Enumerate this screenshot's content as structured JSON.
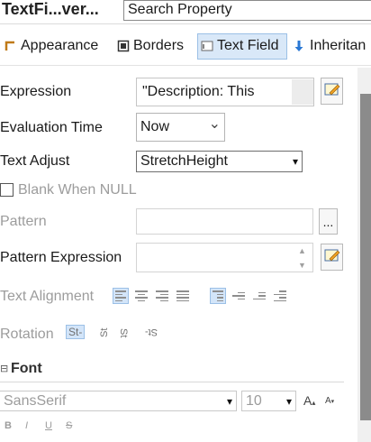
{
  "header": {
    "title": "TextFi...ver...",
    "search_value": "Search Property"
  },
  "tabs": [
    {
      "label": "Appearance"
    },
    {
      "label": "Borders"
    },
    {
      "label": "Text Field"
    },
    {
      "label": "Inheritan"
    }
  ],
  "properties": {
    "expression": {
      "label": "Expression",
      "value": "\"Description: This"
    },
    "evaluation_time": {
      "label": "Evaluation Time",
      "value": "Now"
    },
    "text_adjust": {
      "label": "Text Adjust",
      "value": "StretchHeight"
    },
    "blank_when_null": {
      "label": "Blank When NULL",
      "checked": false
    },
    "pattern": {
      "label": "Pattern",
      "value": "",
      "button_label": "..."
    },
    "pattern_expression": {
      "label": "Pattern Expression",
      "value": ""
    },
    "text_alignment": {
      "label": "Text Alignment"
    },
    "rotation": {
      "label": "Rotation"
    }
  },
  "font_section": {
    "title": "Font",
    "expander": "⊟",
    "family": "SansSerif",
    "size": "10",
    "grow_label": "A",
    "shrink_label": "A",
    "style_labels": [
      "B",
      "I",
      "U",
      "S"
    ]
  },
  "glyphs": {
    "chevron_down": "⌄",
    "dropdown_arrow": "▾",
    "spin_up": "▲",
    "spin_down": "▼",
    "rotation_icons": [
      "St-",
      "ꟷ",
      "ᴙ",
      "ɿ"
    ]
  },
  "colors": {
    "active_tab_bg": "#d9e8f8",
    "active_tab_border": "#9cc0e6",
    "disabled_text": "#9c9c9c",
    "scroll_thumb": "#8b8b8b"
  }
}
